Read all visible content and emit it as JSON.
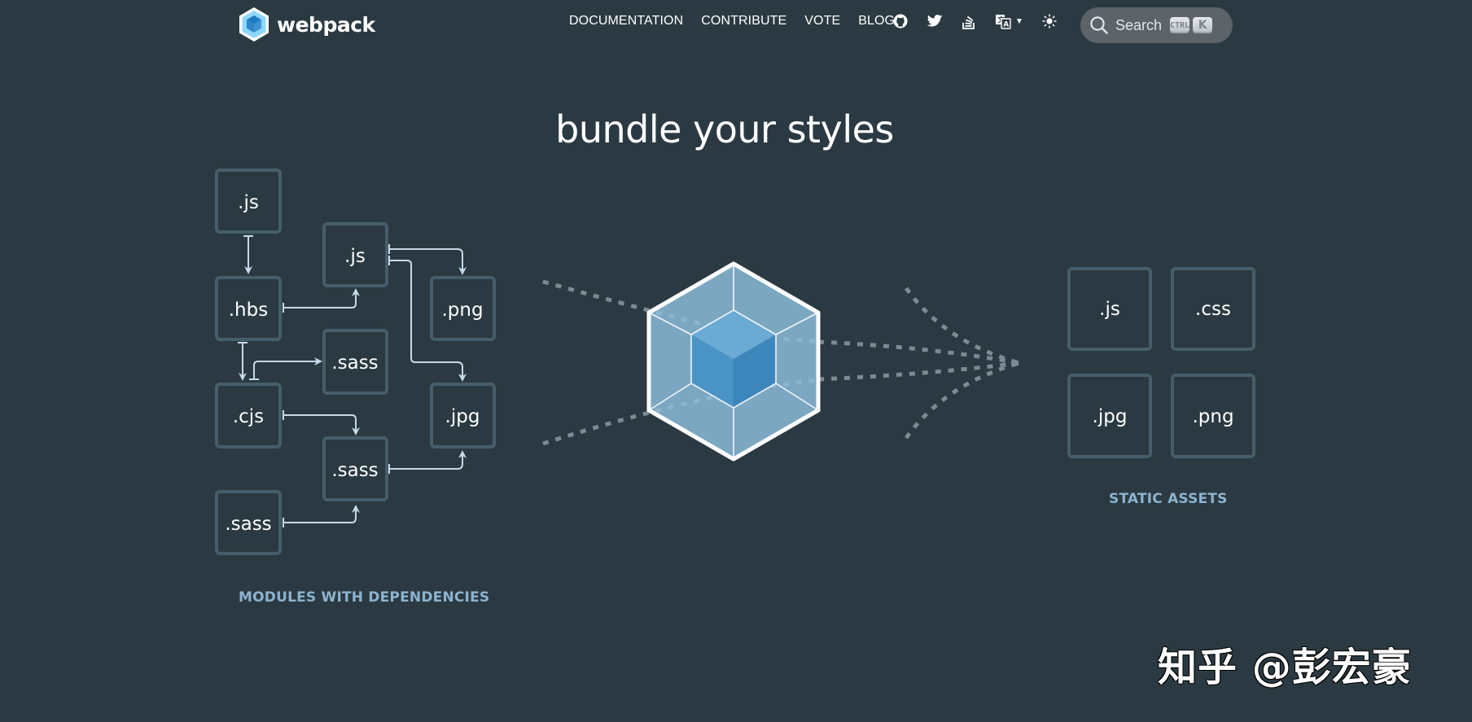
{
  "header": {
    "brand": "webpack",
    "nav_links": [
      {
        "label": "DOCUMENTATION"
      },
      {
        "label": "CONTRIBUTE"
      },
      {
        "label": "VOTE"
      },
      {
        "label": "BLOG"
      }
    ],
    "icons": [
      "github-icon",
      "twitter-icon",
      "stackoverflow-icon",
      "translate-icon",
      "theme-icon"
    ],
    "search": {
      "label": "Search",
      "shortcut_keys": [
        "CTRL",
        "K"
      ]
    }
  },
  "hero": {
    "headline": "bundle your styles",
    "modules": [
      ".js",
      ".js",
      ".hbs",
      ".png",
      ".sass",
      ".cjs",
      ".jpg",
      ".sass",
      ".sass"
    ],
    "modules_caption": "MODULES WITH DEPENDENCIES",
    "assets": [
      ".js",
      ".css",
      ".jpg",
      ".png"
    ],
    "assets_caption": "STATIC ASSETS"
  },
  "watermark": "知乎 @彭宏豪",
  "colors": {
    "background": "#2b3a42",
    "box_border": "#465e6b",
    "arrow": "#c6d9e8",
    "caption": "#8db3cf",
    "cube_light": "#8fc0dd",
    "cube_dark": "#4a93c6"
  }
}
